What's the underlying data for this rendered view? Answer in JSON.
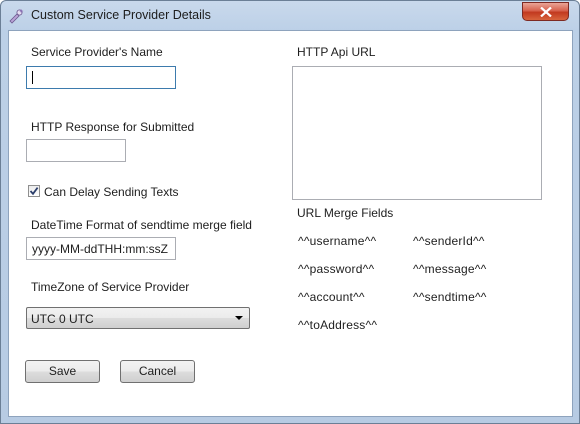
{
  "window": {
    "title": "Custom Service Provider Details"
  },
  "form": {
    "provider_name_label": "Service Provider's Name",
    "provider_name_value": "",
    "http_response_label": "HTTP Response for Submitted",
    "http_response_value": "",
    "delay_checkbox_label": "Can Delay Sending Texts",
    "delay_checked": true,
    "datetime_format_label": "DateTime Format of sendtime merge field",
    "datetime_format_value": "yyyy-MM-ddTHH:mm:ssZ",
    "timezone_label": "TimeZone of Service Provider",
    "timezone_value": "UTC 0 UTC",
    "api_url_label": "HTTP Api URL",
    "api_url_value": "",
    "merge_fields_label": "URL Merge Fields",
    "merge_fields": {
      "username": "^^username^^",
      "senderId": "^^senderId^^",
      "password": "^^password^^",
      "message": "^^message^^",
      "account": "^^account^^",
      "sendtime": "^^sendtime^^",
      "toAddress": "^^toAddress^^"
    }
  },
  "buttons": {
    "save": "Save",
    "cancel": "Cancel"
  },
  "icons": {
    "app": "app-icon",
    "close": "close-icon",
    "checkmark": "checkmark-icon",
    "dropdown": "chevron-down-icon"
  }
}
